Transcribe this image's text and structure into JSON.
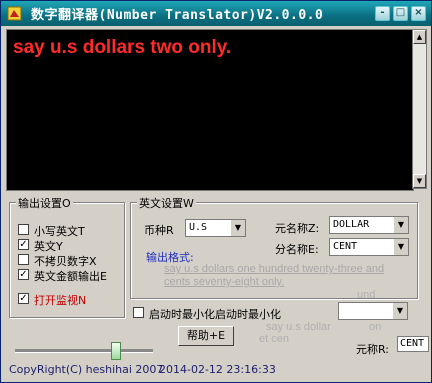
{
  "window": {
    "title": "数字翻译器(Number Translator)V2.0.0.0",
    "minimize_glyph": "-",
    "maximize_glyph": "□",
    "close_glyph": "×"
  },
  "output": {
    "text": "say u.s dollars two only."
  },
  "output_settings": {
    "title": "输出设置O",
    "options": [
      {
        "label": "小写英文T",
        "checked": false
      },
      {
        "label": "英文Y",
        "checked": true
      },
      {
        "label": "不拷贝数字X",
        "checked": false
      },
      {
        "label": "英文金额输出E",
        "checked": true
      }
    ],
    "monitor": {
      "label": "打开监视N",
      "checked": true
    }
  },
  "english_settings": {
    "title": "英文设置W",
    "currency_label": "币种R",
    "currency_value": "U.S",
    "unit_label": "元名称Z:",
    "unit_value": "DOLLAR",
    "sub_unit_label": "分名称E:",
    "sub_unit_value": "CENT",
    "format_label": "输出格式:",
    "format_example": "say u.s dollars one hundred twenty-three and cents seventy-eight only."
  },
  "startup": {
    "label": "启动时最小化启动时最小化",
    "checked": false
  },
  "ghosts": {
    "a": "und",
    "b": "et cen",
    "c": "say u.s dollar",
    "d": "on",
    "e": "元称R:",
    "f": "CENT"
  },
  "help_button": "帮助+E",
  "footer": {
    "copyright": "CopyRight(C) heshihai 2007",
    "datetime": "2014-02-12 23:16:33"
  },
  "icons": {
    "dropdown": "▼",
    "check": "✓",
    "scroll_up": "▲",
    "scroll_down": "▼"
  }
}
